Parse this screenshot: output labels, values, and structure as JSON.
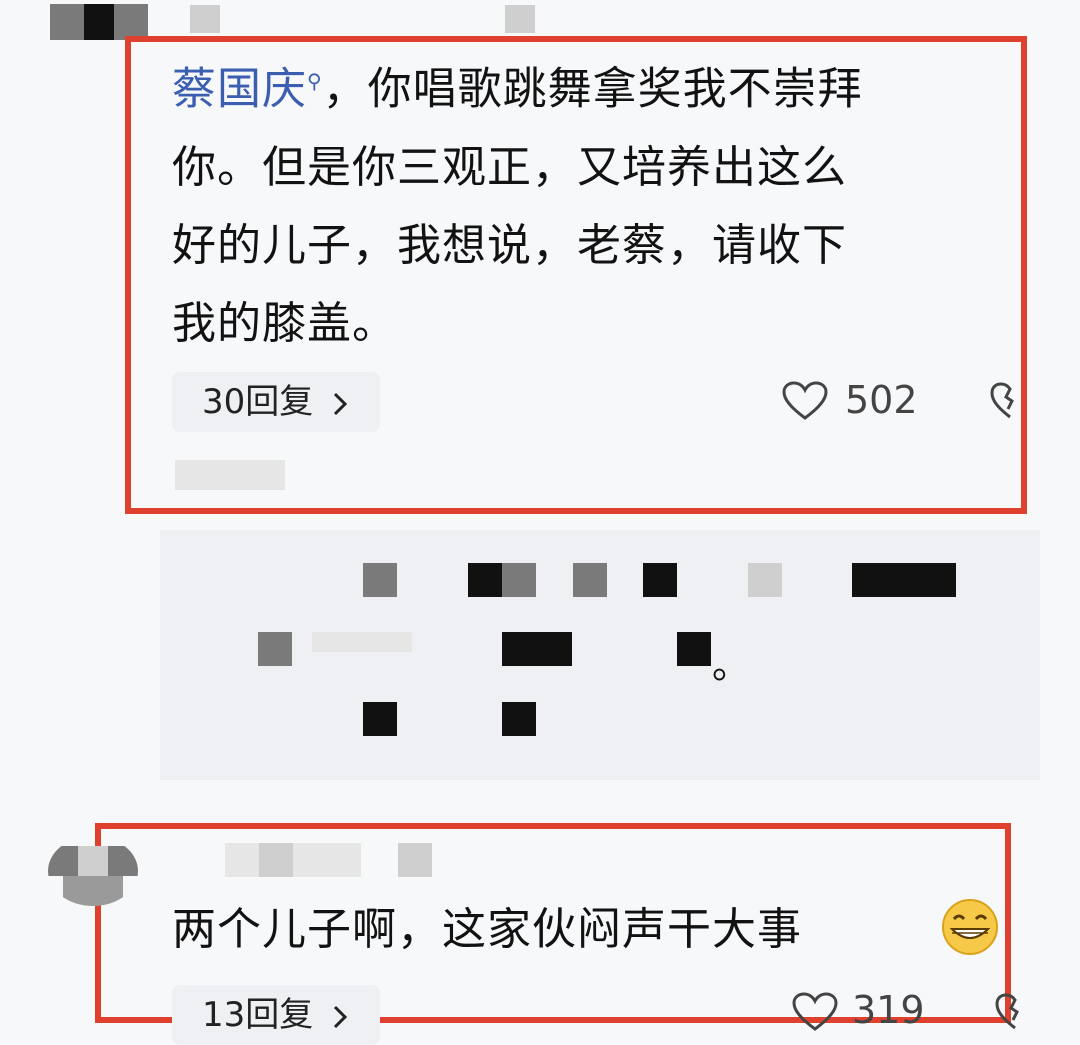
{
  "comment1": {
    "mention": "蔡国庆",
    "line1_rest": "，你唱歌跳舞拿奖我不崇拜",
    "line2": "你。但是你三观正，又培养出这么",
    "line3": "好的儿子，我想说，老蔡，请收下",
    "line4": "我的膝盖。",
    "replies_label": "30回复",
    "likes": "502"
  },
  "quote": {
    "end_mark": "。"
  },
  "comment2": {
    "text": "两个儿子啊，这家伙闷声干大事",
    "replies_label": "13回复",
    "likes": "319"
  },
  "colors": {
    "highlight_border": "#e0412e",
    "mention": "#3b5eb0",
    "chip_bg": "#eef0f3"
  },
  "icons": [
    "search-icon",
    "chevron-right-icon",
    "heart-icon",
    "broken-heart-icon",
    "grinning-emoji-icon"
  ]
}
